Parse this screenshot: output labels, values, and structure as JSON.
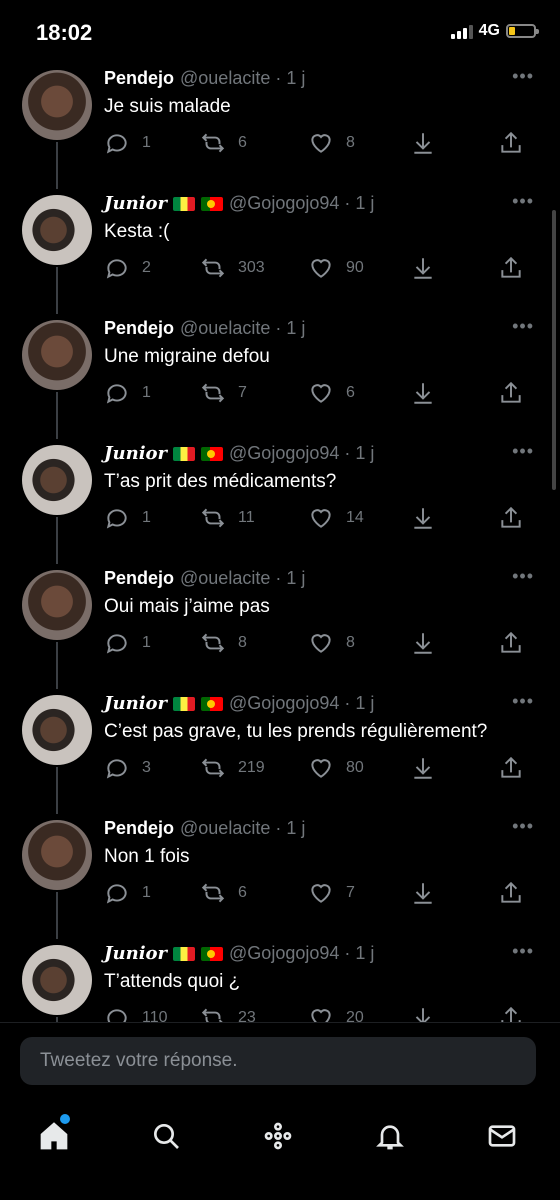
{
  "status_bar": {
    "time": "18:02",
    "network": "4G",
    "battery_level": 0.25,
    "signal_bars": 3
  },
  "colors": {
    "accent": "#1d9bf0",
    "background": "#000000",
    "muted": "#71767b"
  },
  "tweets": [
    {
      "name": "Pendejo",
      "handle": "@ouelacite",
      "time": "· 1 j",
      "text": "Je suis malade",
      "replies": "1",
      "retweets": "6",
      "likes": "8"
    },
    {
      "name": "Junior",
      "handle": "@Gojogojo94",
      "time": "· 1 j",
      "text": "Kesta :(",
      "replies": "2",
      "retweets": "303",
      "likes": "90"
    },
    {
      "name": "Pendejo",
      "handle": "@ouelacite",
      "time": "· 1 j",
      "text": "Une migraine defou",
      "replies": "1",
      "retweets": "7",
      "likes": "6"
    },
    {
      "name": "Junior",
      "handle": "@Gojogojo94",
      "time": "· 1 j",
      "text": "T’as prit des médicaments?",
      "replies": "1",
      "retweets": "11",
      "likes": "14"
    },
    {
      "name": "Pendejo",
      "handle": "@ouelacite",
      "time": "· 1 j",
      "text": "Oui mais j’aime pas",
      "replies": "1",
      "retweets": "8",
      "likes": "8"
    },
    {
      "name": "Junior",
      "handle": "@Gojogojo94",
      "time": "· 1 j",
      "text": "C’est pas grave, tu les prends régulièrement?",
      "replies": "3",
      "retweets": "219",
      "likes": "80"
    },
    {
      "name": "Pendejo",
      "handle": "@ouelacite",
      "time": "· 1 j",
      "text": "Non 1 fois",
      "replies": "1",
      "retweets": "6",
      "likes": "7"
    },
    {
      "name": "Junior",
      "handle": "@Gojogojo94",
      "time": "· 1 j",
      "text": "T’attends quoi ¿",
      "replies": "110",
      "retweets": "23",
      "likes": "20"
    }
  ],
  "reply_box": {
    "placeholder": "Tweetez votre réponse."
  },
  "nav": {
    "items": [
      "home-icon",
      "search-icon",
      "spaces-icon",
      "notifications-icon",
      "messages-icon"
    ]
  }
}
